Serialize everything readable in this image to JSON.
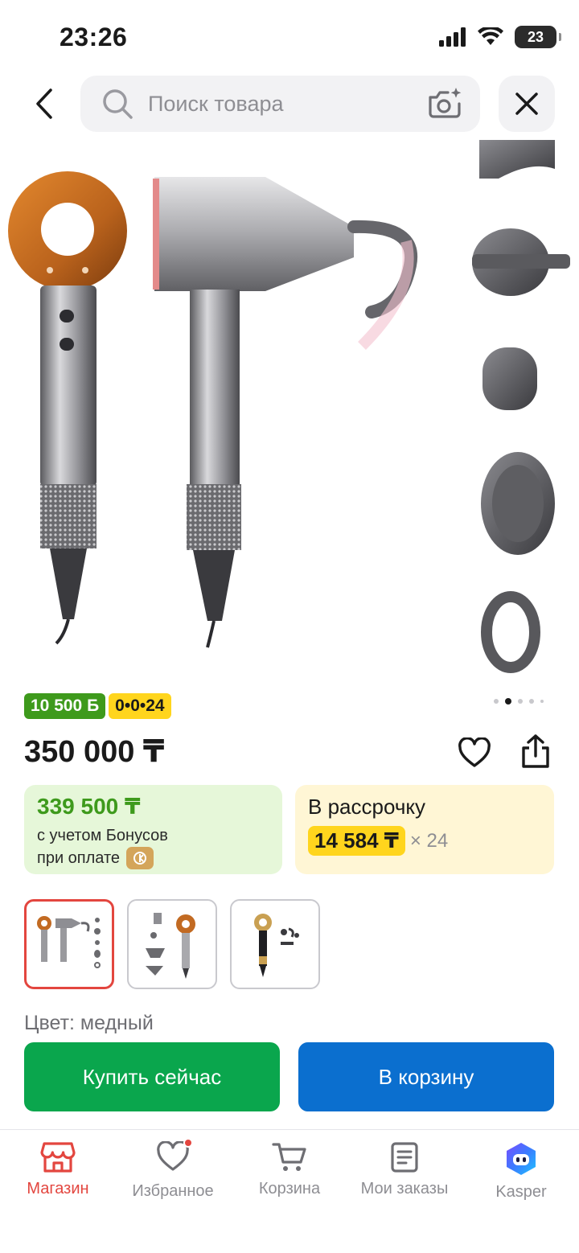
{
  "status_bar": {
    "time": "23:26",
    "battery": "23"
  },
  "search": {
    "placeholder": "Поиск товара"
  },
  "product": {
    "badge_bonus": "10 500 Б",
    "badge_installment": "0•0•24",
    "price": "350 000 ₸",
    "bonus_price": "339 500 ₸",
    "bonus_line1": "с учетом Бонусов",
    "bonus_line2": "при оплате",
    "installment_title": "В рассрочку",
    "installment_amount": "14 584 ₸",
    "installment_multiplier": "× 24",
    "color_label": "Цвет: медный",
    "gallery_pages": 5,
    "gallery_active_page": 2,
    "selected_variant": 1
  },
  "actions": {
    "buy_now": "Купить сейчас",
    "add_to_cart": "В корзину"
  },
  "tabbar": {
    "items": [
      {
        "label": "Магазин",
        "icon": "store-icon",
        "active": true
      },
      {
        "label": "Избранное",
        "icon": "heart-icon",
        "active": false,
        "dot": true
      },
      {
        "label": "Корзина",
        "icon": "cart-icon",
        "active": false
      },
      {
        "label": "Мои заказы",
        "icon": "orders-icon",
        "active": false
      },
      {
        "label": "Kasper",
        "icon": "kasper-icon",
        "active": false
      }
    ]
  },
  "colors": {
    "accent_red": "#e3463f",
    "buy_green": "#0aa64d",
    "cart_blue": "#0b6fcf",
    "bonus_green": "#3e9a1c",
    "installment_yellow": "#ffd51d"
  }
}
